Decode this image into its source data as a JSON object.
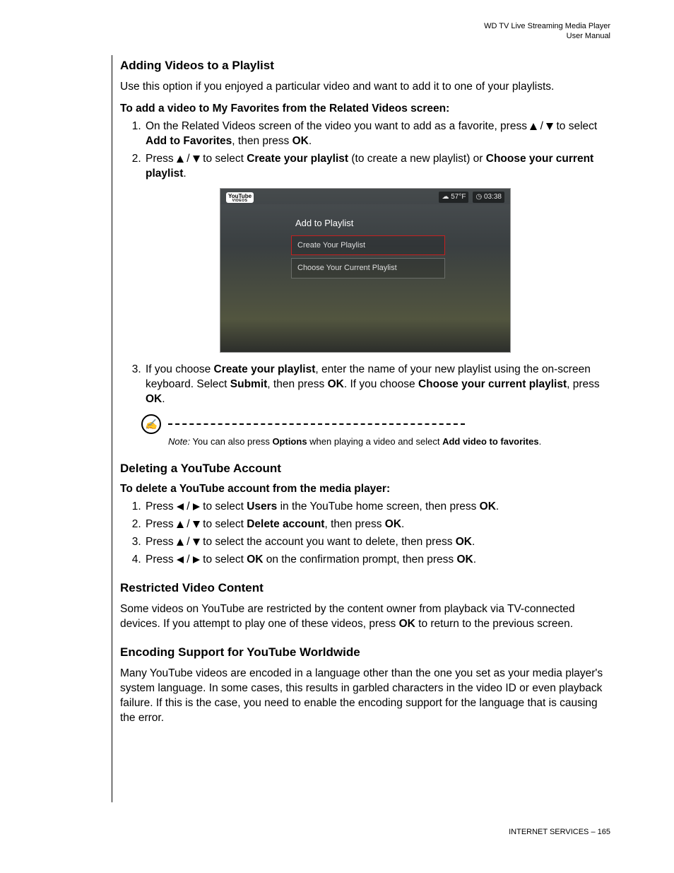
{
  "header": {
    "line1": "WD TV Live Streaming Media Player",
    "line2": "User Manual"
  },
  "sections": {
    "adding": {
      "title": "Adding Videos to a Playlist",
      "intro": "Use this option if you enjoyed a particular video and want to add it to one of your playlists.",
      "subhead": "To add a video to My Favorites from the Related Videos screen:",
      "step1_a": "On the Related Videos screen of the video you want to add as a favorite, press ",
      "step1_b": " to select ",
      "step1_bold1": "Add to Favorites",
      "step1_c": ", then press ",
      "step1_bold2": "OK",
      "step1_d": ".",
      "step2_a": "Press ",
      "step2_b": " to select ",
      "step2_bold1": "Create your playlist",
      "step2_c": " (to create a new playlist) or ",
      "step2_bold2": "Choose your current playlist",
      "step2_d": ".",
      "step3_a": "If you choose ",
      "step3_bold1": "Create your playlist",
      "step3_b": ", enter the name of your new playlist using the on-screen keyboard. Select ",
      "step3_bold2": "Submit",
      "step3_c": ", then press ",
      "step3_bold3": "OK",
      "step3_d": ". If you choose ",
      "step3_bold4": "Choose your current playlist",
      "step3_e": ", press ",
      "step3_bold5": "OK",
      "step3_f": "."
    },
    "screenshot": {
      "logo_top": "YouTube",
      "logo_bottom": "VIDEOS",
      "temp": "57°F",
      "time": "03:38",
      "title": "Add to Playlist",
      "opt1": "Create Your Playlist",
      "opt2": "Choose Your Current Playlist"
    },
    "note": {
      "label": "Note:",
      "text_a": " You can also press ",
      "bold1": "Options",
      "text_b": " when playing a video and select ",
      "bold2": "Add video to favorites",
      "text_c": "."
    },
    "deleting": {
      "title": "Deleting a YouTube Account",
      "subhead": "To delete a YouTube account from the media player:",
      "s1_a": "Press ",
      "s1_b": " to select ",
      "s1_bold1": "Users",
      "s1_c": " in the YouTube home screen, then press ",
      "s1_bold2": "OK",
      "s1_d": ".",
      "s2_a": "Press ",
      "s2_b": " to select ",
      "s2_bold1": "Delete account",
      "s2_c": ", then press ",
      "s2_bold2": "OK",
      "s2_d": ".",
      "s3_a": "Press ",
      "s3_b": " to select the account you want to delete, then press ",
      "s3_bold1": "OK",
      "s3_c": ".",
      "s4_a": "Press ",
      "s4_b": " to select ",
      "s4_bold1": "OK",
      "s4_c": " on the confirmation prompt, then press ",
      "s4_bold2": "OK",
      "s4_d": "."
    },
    "restricted": {
      "title": "Restricted Video Content",
      "body_a": "Some videos on YouTube are restricted by the content owner from playback via TV-connected devices. If you attempt to play one of these videos, press ",
      "bold1": "OK",
      "body_b": " to return to the previous screen."
    },
    "encoding": {
      "title": "Encoding Support for YouTube Worldwide",
      "body": "Many YouTube videos are encoded in a language other than the one you set as your media player's system language. In some cases, this results in garbled characters in the video ID or even playback failure. If this is the case, you need to enable the encoding support for the language that is causing the error."
    }
  },
  "footer": {
    "label": "INTERNET SERVICES – ",
    "page": "165"
  }
}
